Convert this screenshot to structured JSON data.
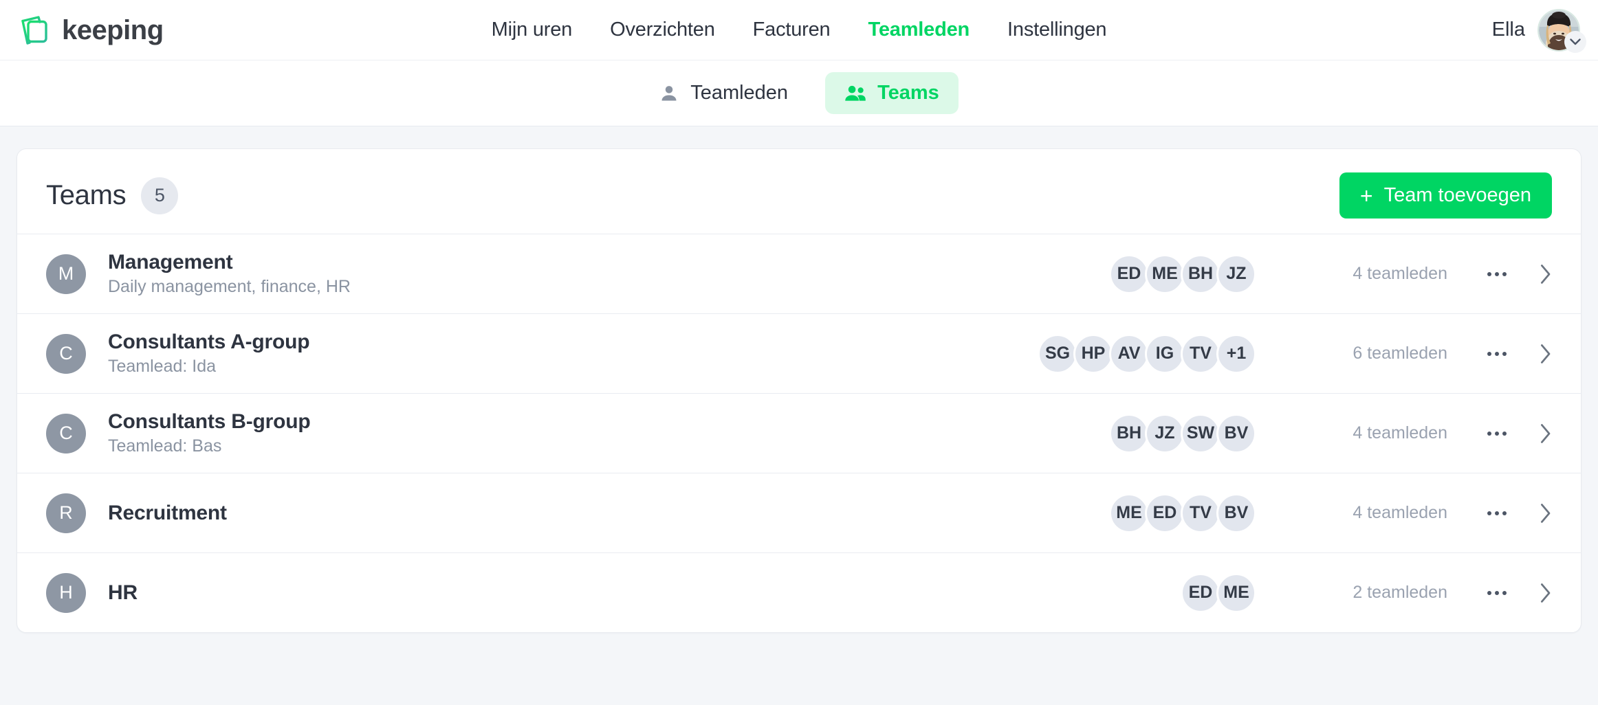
{
  "brand": {
    "name": "keeping",
    "logo_icon": "keeping-notebook-logo",
    "accent": "#00d563"
  },
  "topnav": {
    "items": [
      {
        "label": "Mijn uren",
        "active": false
      },
      {
        "label": "Overzichten",
        "active": false
      },
      {
        "label": "Facturen",
        "active": false
      },
      {
        "label": "Teamleden",
        "active": true
      },
      {
        "label": "Instellingen",
        "active": false
      }
    ]
  },
  "user": {
    "name": "Ella",
    "avatar_icon": "user-avatar-photo",
    "menu_icon": "chevron-down-icon"
  },
  "subnav": {
    "tabs": [
      {
        "label": "Teamleden",
        "icon": "person-icon",
        "active": false
      },
      {
        "label": "Teams",
        "icon": "people-group-icon",
        "active": true
      }
    ]
  },
  "teams_panel": {
    "title": "Teams",
    "count": "5",
    "add_button": {
      "label": "Team toevoegen",
      "icon": "plus-icon"
    },
    "row_menu_icon": "more-options-icon",
    "row_chevron_icon": "chevron-right-icon",
    "rows": [
      {
        "initial": "M",
        "name": "Management",
        "subtitle": "Daily management, finance, HR",
        "members": [
          "ED",
          "ME",
          "BH",
          "JZ"
        ],
        "count_label": "4 teamleden"
      },
      {
        "initial": "C",
        "name": "Consultants A-group",
        "subtitle": "Teamlead: Ida",
        "members": [
          "SG",
          "HP",
          "AV",
          "IG",
          "TV",
          "+1"
        ],
        "count_label": "6 teamleden"
      },
      {
        "initial": "C",
        "name": "Consultants B-group",
        "subtitle": "Teamlead: Bas",
        "members": [
          "BH",
          "JZ",
          "SW",
          "BV"
        ],
        "count_label": "4 teamleden"
      },
      {
        "initial": "R",
        "name": "Recruitment",
        "subtitle": "",
        "members": [
          "ME",
          "ED",
          "TV",
          "BV"
        ],
        "count_label": "4 teamleden"
      },
      {
        "initial": "H",
        "name": "HR",
        "subtitle": "",
        "members": [
          "ED",
          "ME"
        ],
        "count_label": "2 teamleden"
      }
    ]
  }
}
